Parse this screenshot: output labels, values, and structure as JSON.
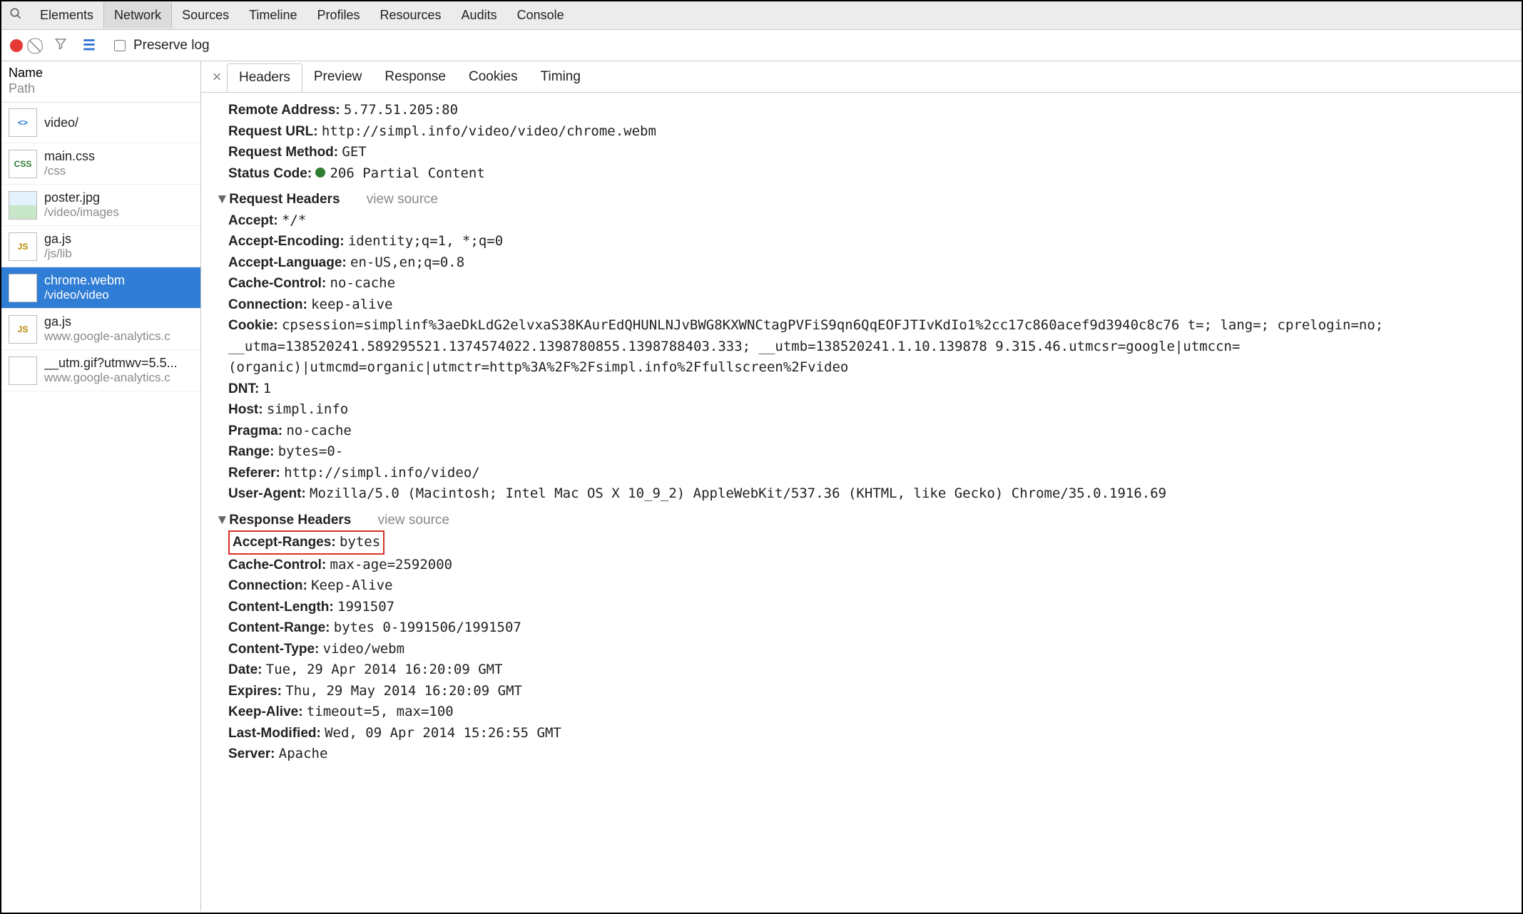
{
  "topTabs": {
    "elements": "Elements",
    "network": "Network",
    "sources": "Sources",
    "timeline": "Timeline",
    "profiles": "Profiles",
    "resources": "Resources",
    "audits": "Audits",
    "console": "Console"
  },
  "toolbar": {
    "preserve": "Preserve log"
  },
  "sidebar": {
    "head": {
      "name": "Name",
      "path": "Path"
    },
    "items": [
      {
        "name": "video/",
        "path": "",
        "kind": "html"
      },
      {
        "name": "main.css",
        "path": "/css",
        "kind": "css"
      },
      {
        "name": "poster.jpg",
        "path": "/video/images",
        "kind": "img"
      },
      {
        "name": "ga.js",
        "path": "/js/lib",
        "kind": "js"
      },
      {
        "name": "chrome.webm",
        "path": "/video/video",
        "kind": "video",
        "selected": true
      },
      {
        "name": "ga.js",
        "path": "www.google-analytics.c",
        "kind": "js"
      },
      {
        "name": "__utm.gif?utmwv=5.5...",
        "path": "www.google-analytics.c",
        "kind": "gif"
      }
    ]
  },
  "detailTabs": {
    "headers": "Headers",
    "preview": "Preview",
    "response": "Response",
    "cookies": "Cookies",
    "timing": "Timing"
  },
  "summary": {
    "remoteAddress_k": "Remote Address:",
    "remoteAddress_v": "5.77.51.205:80",
    "requestUrl_k": "Request URL:",
    "requestUrl_v": "http://simpl.info/video/video/chrome.webm",
    "requestMethod_k": "Request Method:",
    "requestMethod_v": "GET",
    "statusCode_k": "Status Code:",
    "statusCode_v": "206 Partial Content"
  },
  "requestHeaders": {
    "title": "Request Headers",
    "viewSource": "view source",
    "items": [
      {
        "k": "Accept:",
        "v": "*/*"
      },
      {
        "k": "Accept-Encoding:",
        "v": "identity;q=1, *;q=0"
      },
      {
        "k": "Accept-Language:",
        "v": "en-US,en;q=0.8"
      },
      {
        "k": "Cache-Control:",
        "v": "no-cache"
      },
      {
        "k": "Connection:",
        "v": "keep-alive"
      },
      {
        "k": "Cookie:",
        "v": "cpsession=simplinf%3aeDkLdG2elvxaS38KAurEdQHUNLNJvBWG8KXWNCtagPVFiS9qn6QqEOFJTIvKdIo1%2cc17c860acef9d3940c8c76 t=; lang=; cprelogin=no; __utma=138520241.589295521.1374574022.1398780855.1398788403.333; __utmb=138520241.1.10.139878 9.315.46.utmcsr=google|utmccn=(organic)|utmcmd=organic|utmctr=http%3A%2F%2Fsimpl.info%2Ffullscreen%2Fvideo"
      },
      {
        "k": "DNT:",
        "v": "1"
      },
      {
        "k": "Host:",
        "v": "simpl.info"
      },
      {
        "k": "Pragma:",
        "v": "no-cache"
      },
      {
        "k": "Range:",
        "v": "bytes=0-"
      },
      {
        "k": "Referer:",
        "v": "http://simpl.info/video/"
      },
      {
        "k": "User-Agent:",
        "v": "Mozilla/5.0 (Macintosh; Intel Mac OS X 10_9_2) AppleWebKit/537.36 (KHTML, like Gecko) Chrome/35.0.1916.69"
      }
    ]
  },
  "responseHeaders": {
    "title": "Response Headers",
    "viewSource": "view source",
    "items": [
      {
        "k": "Accept-Ranges:",
        "v": "bytes",
        "hl": true
      },
      {
        "k": "Cache-Control:",
        "v": "max-age=2592000"
      },
      {
        "k": "Connection:",
        "v": "Keep-Alive"
      },
      {
        "k": "Content-Length:",
        "v": "1991507"
      },
      {
        "k": "Content-Range:",
        "v": "bytes 0-1991506/1991507"
      },
      {
        "k": "Content-Type:",
        "v": "video/webm"
      },
      {
        "k": "Date:",
        "v": "Tue, 29 Apr 2014 16:20:09 GMT"
      },
      {
        "k": "Expires:",
        "v": "Thu, 29 May 2014 16:20:09 GMT"
      },
      {
        "k": "Keep-Alive:",
        "v": "timeout=5, max=100"
      },
      {
        "k": "Last-Modified:",
        "v": "Wed, 09 Apr 2014 15:26:55 GMT"
      },
      {
        "k": "Server:",
        "v": "Apache"
      }
    ]
  }
}
